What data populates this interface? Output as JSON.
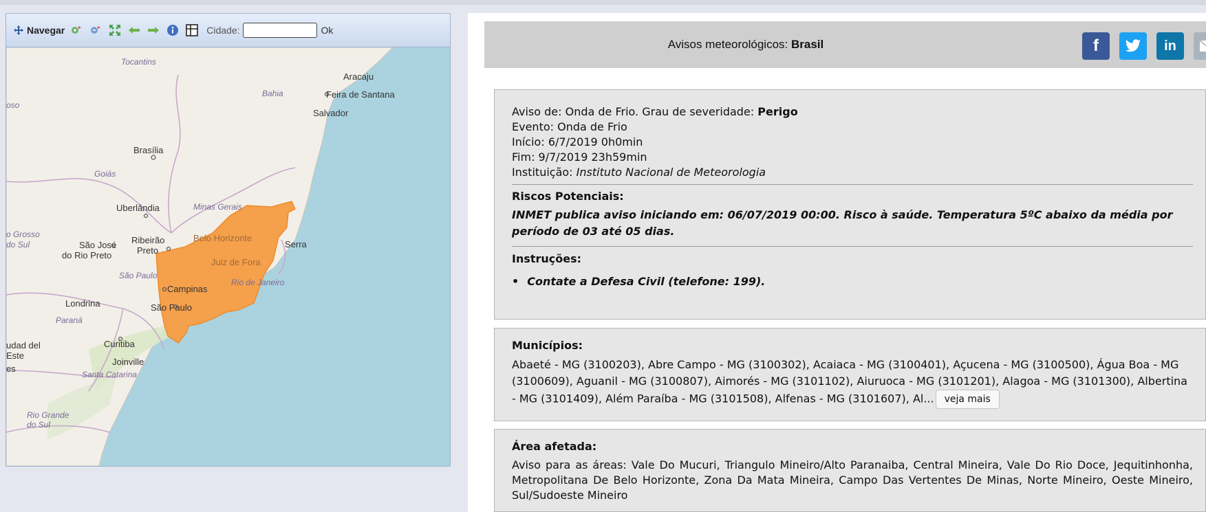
{
  "map": {
    "toolbar": {
      "navegar_label": "Navegar",
      "cidade_label": "Cidade:",
      "cidade_value": "",
      "ok_label": "Ok",
      "icons": [
        "zoom-in-icon",
        "zoom-out-icon",
        "full-extent-icon",
        "back-arrow-icon",
        "forward-arrow-icon",
        "info-icon",
        "grid-icon"
      ]
    },
    "labels": {
      "tocantins": "Tocantins",
      "aracaju": "Aracaju",
      "bahia": "Bahia",
      "feira": "Feira de Santana",
      "salvador": "Salvador",
      "oso": "oso",
      "brasilia": "Brasília",
      "goias": "Goiás",
      "uberlandia": "Uberlândia",
      "minas": "Minas Gerais",
      "grosso1": "o Grosso",
      "grosso2": "do Sul",
      "ribeirao1": "Ribeirão",
      "ribeirao2": "Preto",
      "sjose1": "São José",
      "sjose2": "do Rio Preto",
      "bh": "Belo Horizonte",
      "serra": "Serra",
      "jf": "Juiz de Fora",
      "sp_state": "São Paulo",
      "rio": "Rio de Janeiro",
      "campinas": "Campinas",
      "londrina": "Londrina",
      "sp_city": "São Paulo",
      "parana": "Paraná",
      "udad1": "udad del",
      "udad2": "Este",
      "curitiba": "Curitiba",
      "joinville": "Joinville",
      "es": "es",
      "sc": "Santa Catarina",
      "rgs1": "Rio Grande",
      "rgs2": "do Sul"
    },
    "alert_area_color": "#f5a04b"
  },
  "header": {
    "title_prefix": "Avisos meteorológicos:",
    "title_region": "Brasil",
    "share": {
      "facebook_glyph": "f",
      "linkedin_glyph": "in"
    }
  },
  "alert": {
    "aviso_prefix": "Aviso de: Onda de Frio. Grau de severidade:",
    "severity": "Perigo",
    "evento": "Evento: Onda de Frio",
    "inicio": "Início: 6/7/2019 0h0min",
    "fim": "Fim: 9/7/2019 23h59min",
    "instituicao_label": "Instituição:",
    "instituicao": "Instituto Nacional de Meteorologia",
    "riscos_title": "Riscos Potenciais:",
    "riscos_text": "INMET publica aviso iniciando em: 06/07/2019 00:00. Risco à saúde. Temperatura 5ºC abaixo da média por período de 03 até 05 dias.",
    "instrucoes_title": "Instruções:",
    "instrucoes": [
      "Contate a Defesa Civil (telefone: 199)."
    ]
  },
  "municipios": {
    "title": "Municípios:",
    "text": "Abaeté - MG (3100203), Abre Campo - MG (3100302), Acaiaca - MG (3100401), Açucena - MG (3100500), Água Boa - MG (3100609), Aguanil - MG (3100807), Aimorés - MG (3101102), Aiuruoca - MG (3101201), Alagoa - MG (3101300), Albertina - MG (3101409), Além Paraíba - MG (3101508), Alfenas - MG (3101607), Al...",
    "more_label": "veja mais"
  },
  "area": {
    "title": "Área afetada:",
    "text": "Aviso para as áreas: Vale Do Mucuri, Triangulo Mineiro/Alto Paranaiba, Central Mineira, Vale Do Rio Doce, Jequitinhonha, Metropolitana De Belo Horizonte, Zona Da Mata Mineira, Campo Das Vertentes De Minas, Norte Mineiro, Oeste Mineiro, Sul/Sudoeste Mineiro"
  }
}
